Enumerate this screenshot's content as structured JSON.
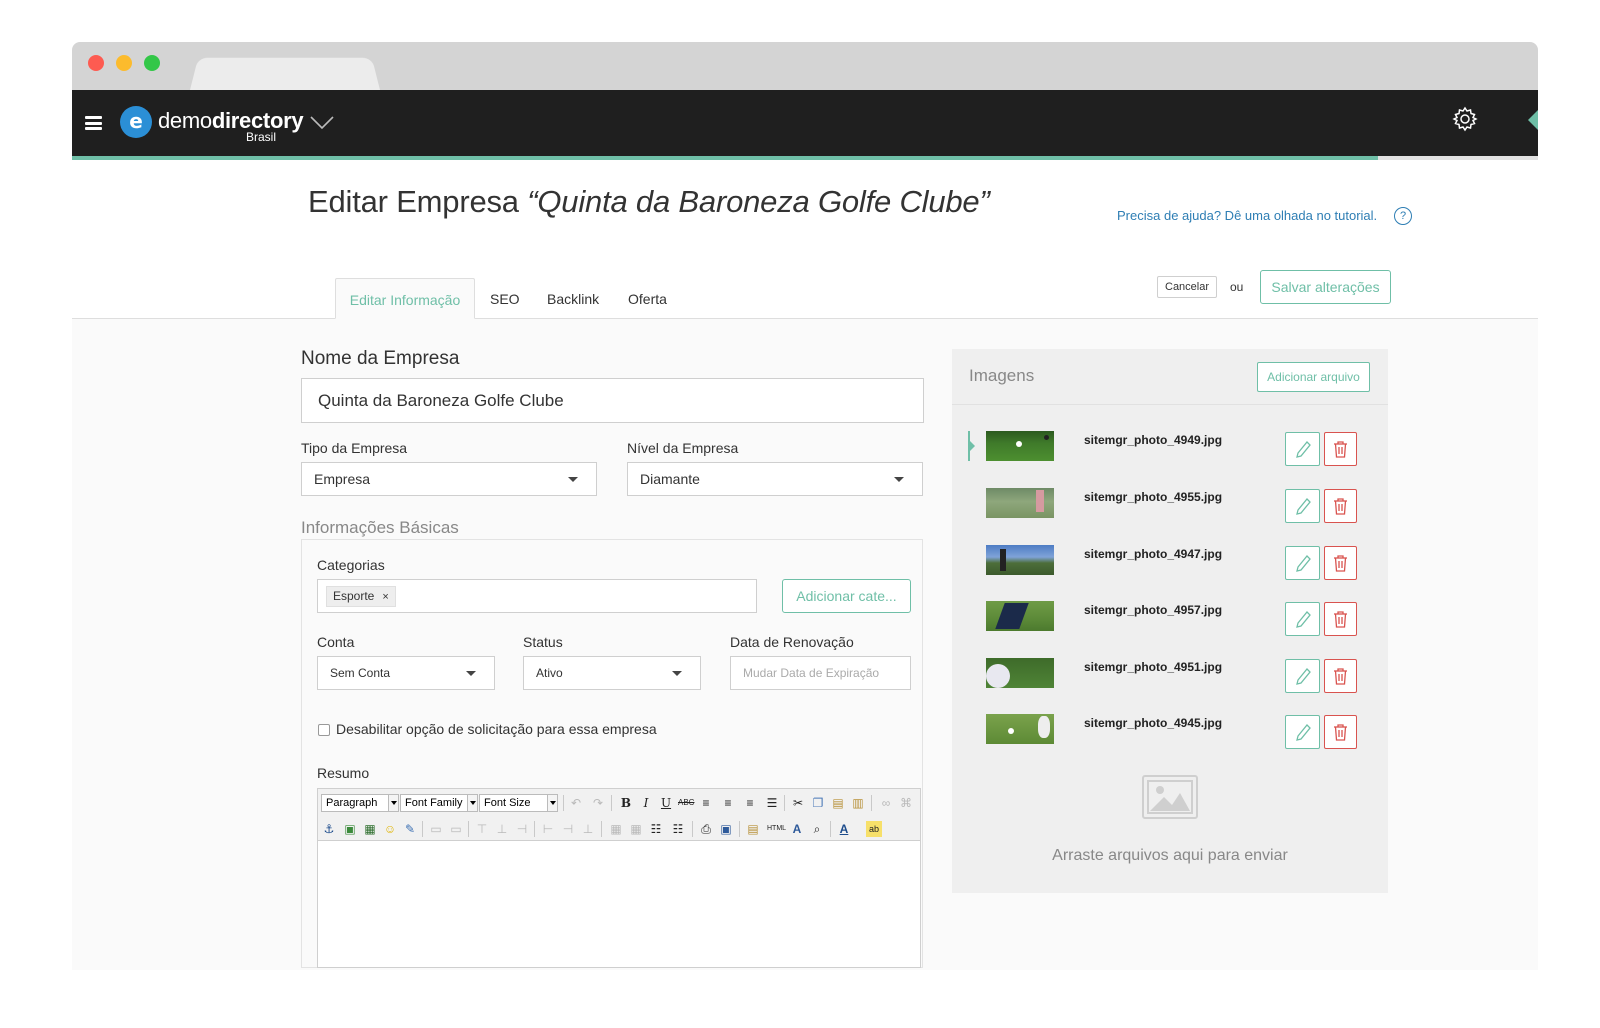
{
  "app": {
    "logo_letter": "e",
    "logo_light": "demo",
    "logo_bold": "directory",
    "logo_sub": "Brasil"
  },
  "page": {
    "title_prefix": "Editar Empresa",
    "title_name": "“Quinta da Baroneza Golfe Clube”",
    "help_text": "Precisa de ajuda? Dê uma olhada no tutorial.",
    "help_icon": "?"
  },
  "tabs": [
    {
      "label": "Editar Informação",
      "active": true
    },
    {
      "label": "SEO"
    },
    {
      "label": "Backlink"
    },
    {
      "label": "Oferta"
    }
  ],
  "actions": {
    "cancel": "Cancelar",
    "or": "ou",
    "save": "Salvar alterações"
  },
  "form": {
    "company_name_label": "Nome da Empresa",
    "company_name_value": "Quinta da Baroneza Golfe Clube",
    "type_label": "Tipo da Empresa",
    "type_value": "Empresa",
    "level_label": "Nível da Empresa",
    "level_value": "Diamante",
    "basic_info_title": "Informações Básicas",
    "categories_label": "Categorias",
    "category_tag": "Esporte",
    "category_tag_remove": "×",
    "add_category": "Adicionar cate...",
    "account_label": "Conta",
    "account_value": "Sem Conta",
    "status_label": "Status",
    "status_value": "Ativo",
    "renewal_label": "Data de Renovação",
    "renewal_placeholder": "Mudar Data de Expiração",
    "disable_claim_label": "Desabilitar opção de solicitação para essa empresa",
    "summary_label": "Resumo"
  },
  "editor": {
    "format_select": "Paragraph",
    "font_family_select": "Font Family",
    "font_size_select": "Font Size",
    "buttons_row1": [
      "undo",
      "redo",
      "bold",
      "italic",
      "underline",
      "strikethrough",
      "align-left",
      "align-center",
      "align-right",
      "align-justify",
      "cut",
      "copy",
      "paste",
      "paste-text",
      "link",
      "unlink"
    ],
    "buttons_row2": [
      "anchor",
      "image",
      "media",
      "emoticons",
      "edit",
      "table-1",
      "table-2",
      "row-1",
      "row-2",
      "row-3",
      "col-1",
      "col-2",
      "col-3",
      "table-3",
      "table-4",
      "bullet-list",
      "numbered-list",
      "print",
      "preview",
      "template",
      "html",
      "font-a",
      "find",
      "text-color",
      "highlight"
    ]
  },
  "images": {
    "title": "Imagens",
    "add_file": "Adicionar arquivo",
    "files": [
      {
        "name": "sitemgr_photo_4949.jpg",
        "selected": true
      },
      {
        "name": "sitemgr_photo_4955.jpg"
      },
      {
        "name": "sitemgr_photo_4947.jpg"
      },
      {
        "name": "sitemgr_photo_4957.jpg"
      },
      {
        "name": "sitemgr_photo_4951.jpg"
      },
      {
        "name": "sitemgr_photo_4945.jpg"
      }
    ],
    "drop_text": "Arraste arquivos aqui para enviar"
  },
  "colors": {
    "accent": "#6fbfa7",
    "topbar": "#1f1f1f",
    "link": "#2e7eb4",
    "danger": "#d9534f"
  },
  "icons": [
    "hamburger-icon",
    "chevron-down-icon",
    "gear-icon",
    "help-icon",
    "pencil-icon",
    "trash-icon",
    "image-placeholder-icon"
  ]
}
